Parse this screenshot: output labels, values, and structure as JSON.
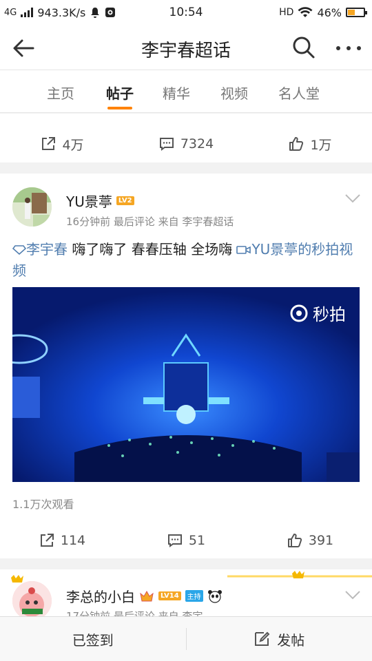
{
  "status_bar": {
    "network": "4G",
    "speed": "943.3K/s",
    "time": "10:54",
    "hd": "HD",
    "battery_percent": "46%",
    "battery_level": 0.46
  },
  "nav": {
    "title": "李宇春超话",
    "back_icon": "arrow-left-icon",
    "search_icon": "search-icon",
    "more_icon": "more-dots-icon"
  },
  "tabs": [
    {
      "label": "主页",
      "active": false
    },
    {
      "label": "帖子",
      "active": true
    },
    {
      "label": "精华",
      "active": false
    },
    {
      "label": "视频",
      "active": false
    },
    {
      "label": "名人堂",
      "active": false
    }
  ],
  "prev_post_actions": {
    "repost": "4万",
    "comment": "7324",
    "like": "1万"
  },
  "post1": {
    "author": "YU景葶",
    "level": "LV2",
    "meta": "16分钟前 最后评论   来自 李宇春超话",
    "text": {
      "mention": "李宇春",
      "body": " 嗨了嗨了 春春压轴 全场嗨 ",
      "video_link": "YU景葶的秒拍视频"
    },
    "video_watermark": "秒拍",
    "views": "1.1万次观看",
    "actions": {
      "repost": "114",
      "comment": "51",
      "like": "391"
    }
  },
  "post2": {
    "author": "李总的小白",
    "level": "LV14",
    "tag": "主持",
    "meta": "17分钟前 最后评论   来自 李宇"
  },
  "bottom_bar": {
    "checked_in": "已签到",
    "post": "发帖"
  },
  "colors": {
    "accent": "#ff8200",
    "link": "#507daf"
  }
}
